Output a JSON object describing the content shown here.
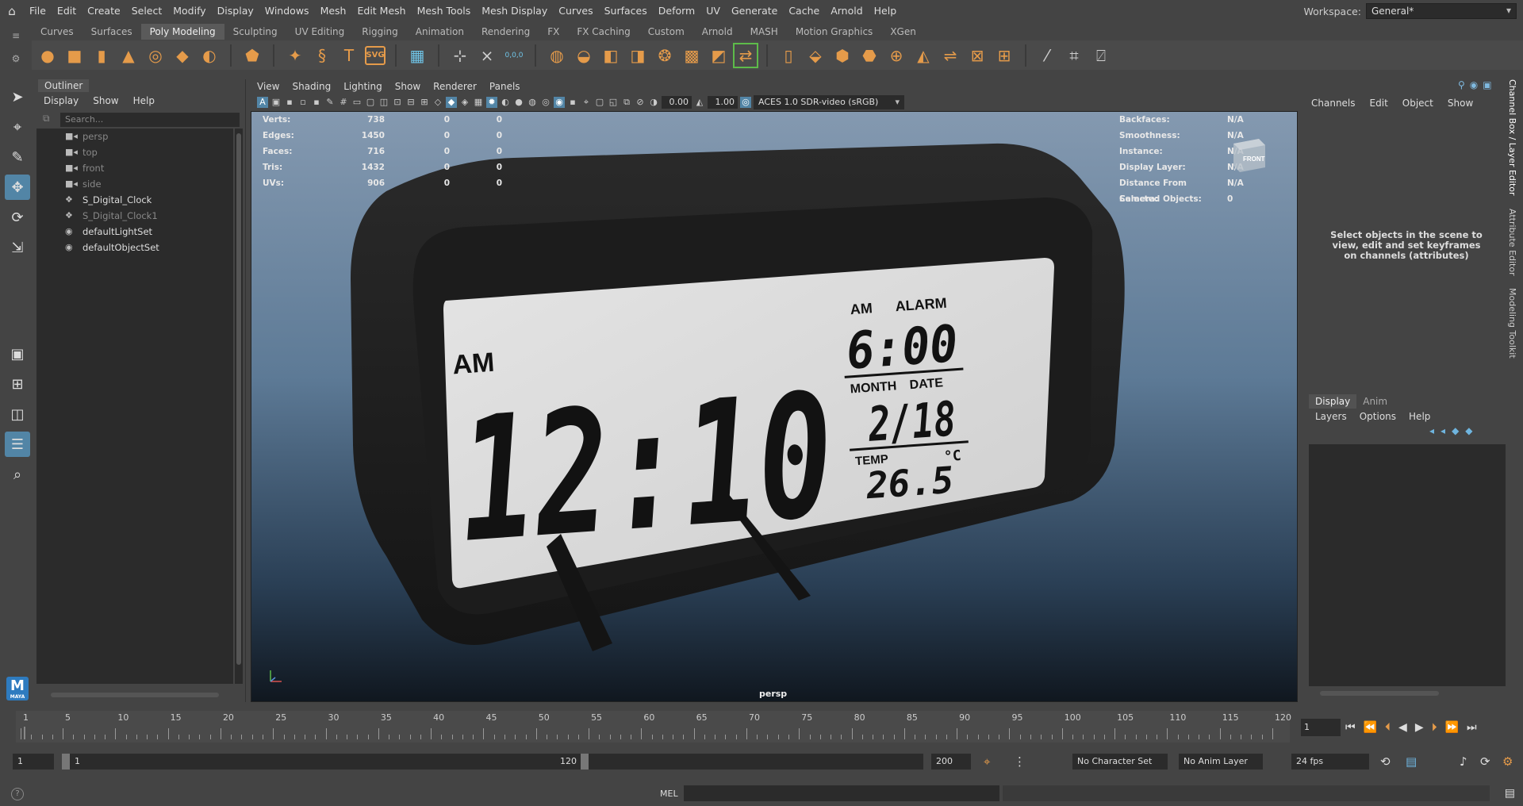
{
  "menubar": {
    "items": [
      "File",
      "Edit",
      "Create",
      "Select",
      "Modify",
      "Display",
      "Windows",
      "Mesh",
      "Edit Mesh",
      "Mesh Tools",
      "Mesh Display",
      "Curves",
      "Surfaces",
      "Deform",
      "UV",
      "Generate",
      "Cache",
      "Arnold",
      "Help"
    ],
    "workspace_label": "Workspace:",
    "workspace_value": "General*"
  },
  "shelf": {
    "tabs": [
      "Curves",
      "Surfaces",
      "Poly Modeling",
      "Sculpting",
      "UV Editing",
      "Rigging",
      "Animation",
      "Rendering",
      "FX",
      "FX Caching",
      "Custom",
      "Arnold",
      "MASH",
      "Motion Graphics",
      "XGen"
    ],
    "active_tab": "Poly Modeling",
    "icons": [
      "sphere-icon",
      "cube-icon",
      "cylinder-icon",
      "cone-icon",
      "torus-icon",
      "plane-icon",
      "disc-icon",
      "platonic-icon",
      "star-icon",
      "helix-icon",
      "text-icon",
      "svg-icon",
      "grid-icon",
      "snap-icon",
      "snap-points-icon",
      "transform-icon",
      "combine-icon",
      "separate-icon",
      "extract-icon",
      "boolean-icon",
      "smooth-icon",
      "bevel-icon",
      "bridge-icon",
      "extrude-icon",
      "multicut-icon",
      "target-weld-icon"
    ],
    "svg_label": "SVG",
    "snap_label": "0,0,0"
  },
  "outliner": {
    "title": "Outliner",
    "menu": [
      "Display",
      "Show",
      "Help"
    ],
    "search_placeholder": "Search...",
    "items": [
      {
        "label": "persp",
        "icon": "camera-icon",
        "dim": true
      },
      {
        "label": "top",
        "icon": "camera-icon",
        "dim": true
      },
      {
        "label": "front",
        "icon": "camera-icon",
        "dim": true
      },
      {
        "label": "side",
        "icon": "camera-icon",
        "dim": true
      },
      {
        "label": "S_Digital_Clock",
        "icon": "group-icon",
        "dim": false
      },
      {
        "label": "S_Digital_Clock1",
        "icon": "group-icon",
        "dim": true
      },
      {
        "label": "defaultLightSet",
        "icon": "set-icon",
        "dim": false
      },
      {
        "label": "defaultObjectSet",
        "icon": "set-icon",
        "dim": false
      }
    ]
  },
  "viewport": {
    "menu": [
      "View",
      "Shading",
      "Lighting",
      "Show",
      "Renderer",
      "Panels"
    ],
    "exposure": "0.00",
    "gamma": "1.00",
    "colorspace": "ACES 1.0 SDR-video (sRGB)",
    "camera": "persp",
    "viewcube_label": "FRONT",
    "hud_left": [
      {
        "k": "Verts:",
        "v": "738",
        "a": "0",
        "b": "0"
      },
      {
        "k": "Edges:",
        "v": "1450",
        "a": "0",
        "b": "0"
      },
      {
        "k": "Faces:",
        "v": "716",
        "a": "0",
        "b": "0"
      },
      {
        "k": "Tris:",
        "v": "1432",
        "a": "0",
        "b": "0"
      },
      {
        "k": "UVs:",
        "v": "906",
        "a": "0",
        "b": "0"
      }
    ],
    "hud_right": [
      {
        "k": "Backfaces:",
        "v": "N/A"
      },
      {
        "k": "Smoothness:",
        "v": "N/A"
      },
      {
        "k": "Instance:",
        "v": "N/A"
      },
      {
        "k": "Display Layer:",
        "v": "N/A"
      },
      {
        "k": "Distance From Camera:",
        "v": "N/A"
      },
      {
        "k": "Selected Objects:",
        "v": "0"
      }
    ],
    "clock": {
      "am_big": "AM",
      "time": "12:10",
      "am_small": "AM",
      "alarm_label": "ALARM",
      "alarm_time": "6:00",
      "month_label": "MONTH",
      "date_label": "DATE",
      "date": "2/18",
      "temp_label": "TEMP",
      "temp_unit": "°C",
      "temp": "26.5"
    }
  },
  "channel_box": {
    "menu": [
      "Channels",
      "Edit",
      "Object",
      "Show"
    ],
    "message": "Select objects in the scene to view, edit and set keyframes on channels (attributes)",
    "side_tabs": [
      "Channel Box / Layer Editor",
      "Attribute Editor",
      "Modeling Toolkit"
    ]
  },
  "layer_editor": {
    "tabs": [
      "Display",
      "Anim"
    ],
    "active_tab": "Display",
    "menu": [
      "Layers",
      "Options",
      "Help"
    ]
  },
  "timeline": {
    "ticks": [
      "1",
      "5",
      "10",
      "15",
      "20",
      "25",
      "30",
      "35",
      "40",
      "45",
      "50",
      "55",
      "60",
      "65",
      "70",
      "75",
      "80",
      "85",
      "90",
      "95",
      "100",
      "105",
      "110",
      "115",
      "120"
    ],
    "current_frame": "1"
  },
  "range": {
    "start": "1",
    "inner_start": "1",
    "inner_end": "120",
    "end": "200",
    "character_set": "No Character Set",
    "anim_layer": "No Anim Layer",
    "fps": "24 fps"
  },
  "cmdline": {
    "label": "MEL"
  }
}
